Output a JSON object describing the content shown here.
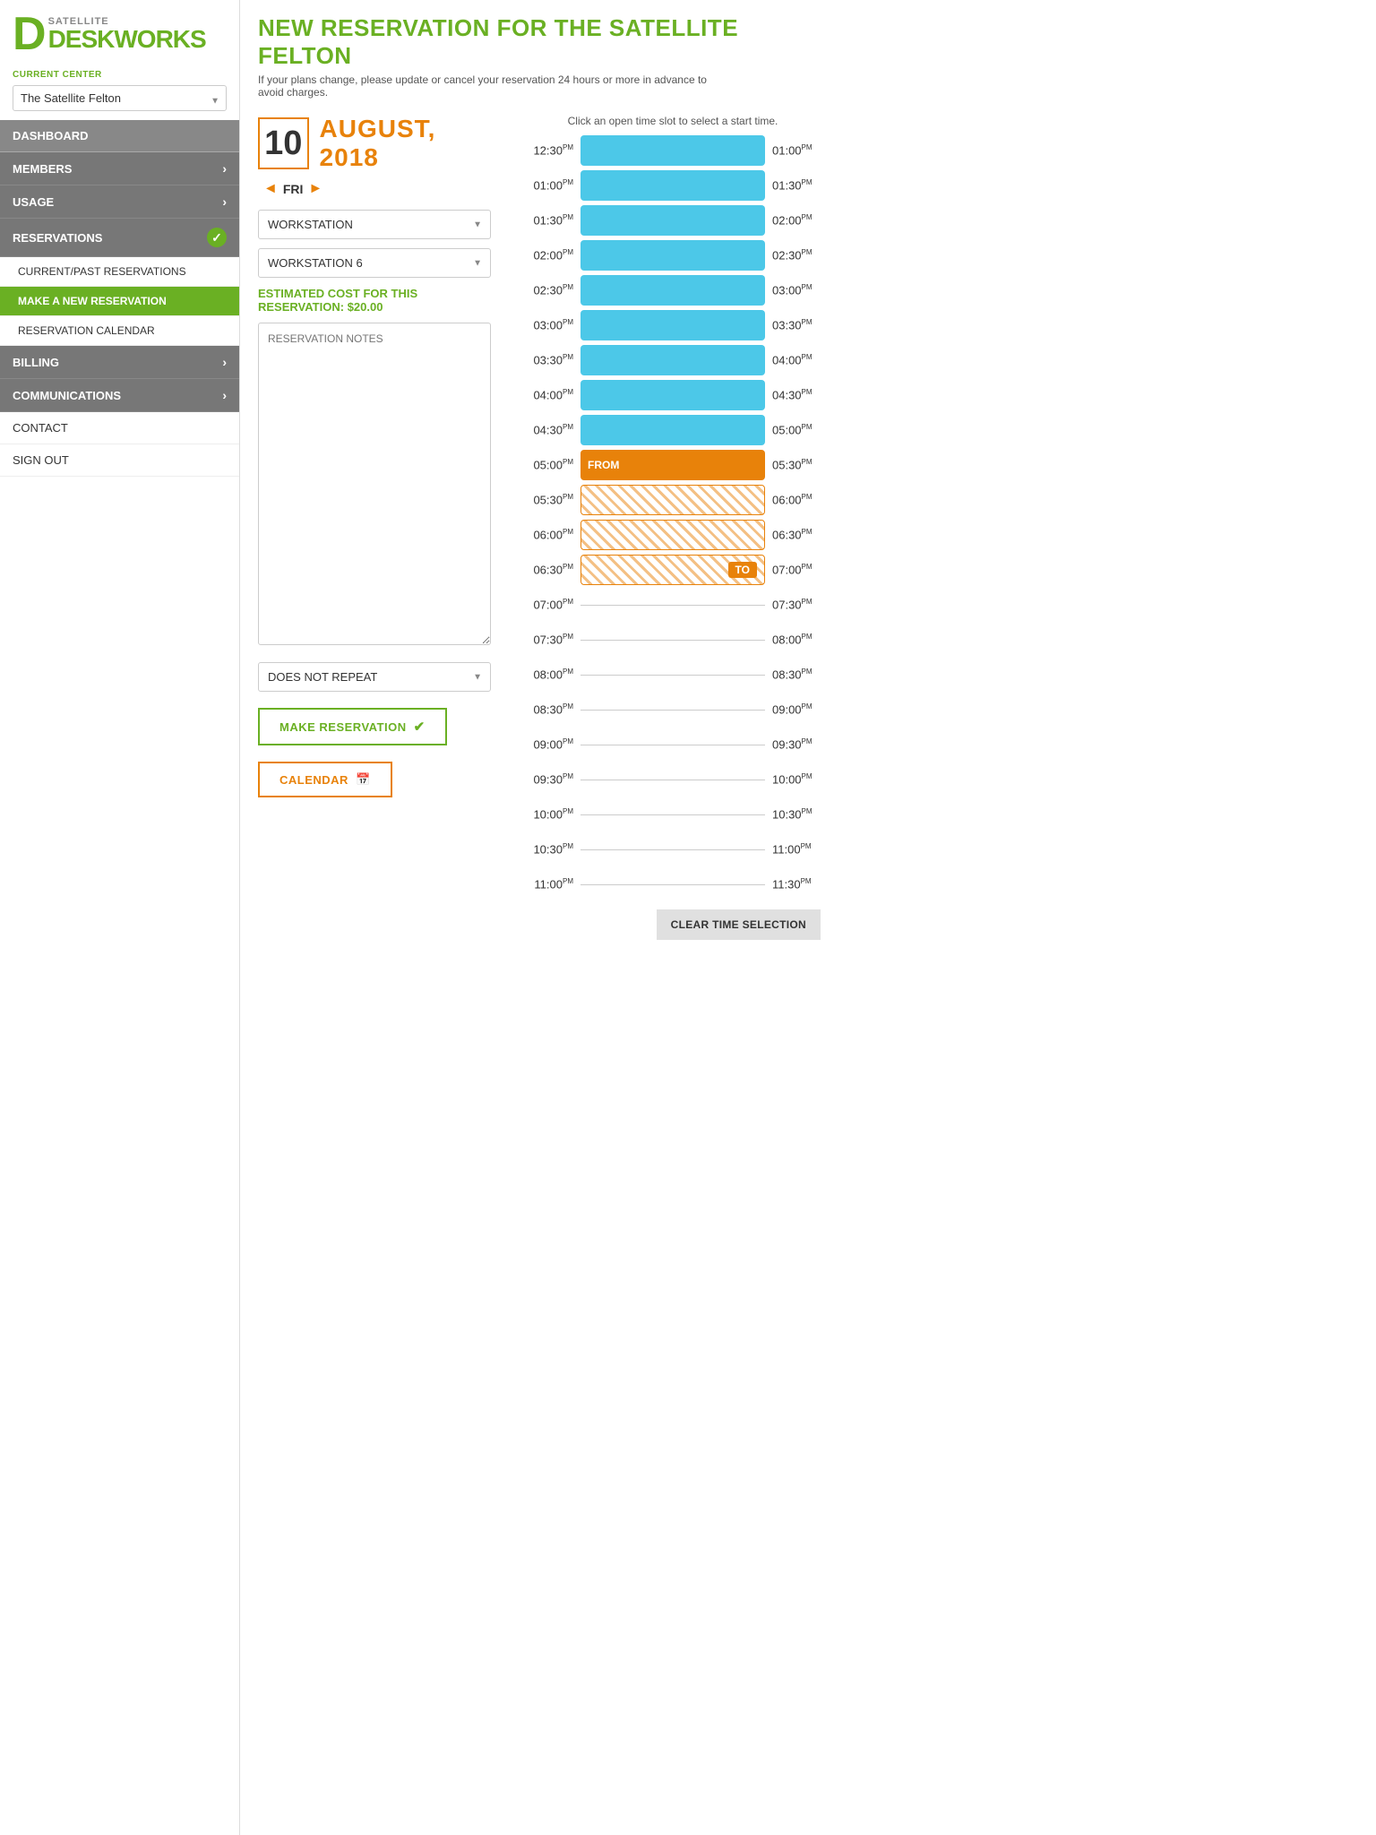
{
  "logo": {
    "d_letter": "D",
    "satellite": "SATELLITE",
    "eskworks": "ESKWORKS"
  },
  "sidebar": {
    "current_center_label": "CURRENT CENTER",
    "current_center": "The Satellite Felton",
    "nav": [
      {
        "id": "dashboard",
        "label": "DASHBOARD",
        "type": "plain-top"
      },
      {
        "id": "members",
        "label": "MEMBERS",
        "type": "expandable"
      },
      {
        "id": "usage",
        "label": "USAGE",
        "type": "expandable"
      },
      {
        "id": "reservations",
        "label": "RESERVATIONS",
        "type": "expandable-active"
      },
      {
        "id": "current-past",
        "label": "CURRENT/PAST RESERVATIONS",
        "type": "sub"
      },
      {
        "id": "make-new",
        "label": "MAKE A NEW RESERVATION",
        "type": "sub-active"
      },
      {
        "id": "calendar",
        "label": "RESERVATION CALENDAR",
        "type": "sub"
      },
      {
        "id": "billing",
        "label": "BILLING",
        "type": "expandable"
      },
      {
        "id": "communications",
        "label": "COMMUNICATIONS",
        "type": "expandable"
      },
      {
        "id": "contact",
        "label": "CONTACT",
        "type": "plain"
      },
      {
        "id": "signout",
        "label": "SIGN OUT",
        "type": "plain"
      }
    ]
  },
  "page": {
    "title": "NEW RESERVATION FOR THE SATELLITE FELTON",
    "subtitle": "If your plans change, please update or cancel your reservation 24 hours or more in advance to avoid charges.",
    "date_number": "10",
    "month_year": "AUGUST, 2018",
    "day_label": "FRI",
    "resource_type": "WORKSTATION",
    "resource_name": "WORKSTATION 6",
    "estimated_cost_label": "ESTIMATED COST FOR THIS",
    "reservation_label": "RESERVATION:",
    "estimated_cost_value": "$20.00",
    "notes_placeholder": "RESERVATION NOTES",
    "repeat_option": "DOES NOT REPEAT",
    "btn_make_reservation": "MAKE RESERVATION",
    "btn_calendar": "CALENDAR",
    "btn_clear": "CLEAR TIME SELECTION",
    "time_hint": "Click an open time slot to select a start time."
  },
  "time_slots": [
    {
      "left": "12:30",
      "left_sup": "PM",
      "type": "blue",
      "right": "01:00",
      "right_sup": "PM"
    },
    {
      "left": "01:00",
      "left_sup": "PM",
      "type": "blue",
      "right": "01:30",
      "right_sup": "PM"
    },
    {
      "left": "01:30",
      "left_sup": "PM",
      "type": "blue",
      "right": "02:00",
      "right_sup": "PM"
    },
    {
      "left": "02:00",
      "left_sup": "PM",
      "type": "blue",
      "right": "02:30",
      "right_sup": "PM"
    },
    {
      "left": "02:30",
      "left_sup": "PM",
      "type": "blue",
      "right": "03:00",
      "right_sup": "PM"
    },
    {
      "left": "03:00",
      "left_sup": "PM",
      "type": "blue",
      "right": "03:30",
      "right_sup": "PM"
    },
    {
      "left": "03:30",
      "left_sup": "PM",
      "type": "blue",
      "right": "04:00",
      "right_sup": "PM"
    },
    {
      "left": "04:00",
      "left_sup": "PM",
      "type": "blue",
      "right": "04:30",
      "right_sup": "PM"
    },
    {
      "left": "04:30",
      "left_sup": "PM",
      "type": "blue",
      "right": "05:00",
      "right_sup": "PM"
    },
    {
      "left": "05:00",
      "left_sup": "PM",
      "type": "orange-from",
      "bar_label": "FROM",
      "right": "05:30",
      "right_sup": "PM"
    },
    {
      "left": "05:30",
      "left_sup": "PM",
      "type": "orange-hatched",
      "right": "06:00",
      "right_sup": "PM"
    },
    {
      "left": "06:00",
      "left_sup": "PM",
      "type": "orange-hatched",
      "right": "06:30",
      "right_sup": "PM"
    },
    {
      "left": "06:30",
      "left_sup": "PM",
      "type": "orange-to",
      "bar_label": "TO",
      "right": "07:00",
      "right_sup": "PM"
    },
    {
      "left": "07:00",
      "left_sup": "PM",
      "type": "empty",
      "right": "07:30",
      "right_sup": "PM"
    },
    {
      "left": "07:30",
      "left_sup": "PM",
      "type": "empty",
      "right": "08:00",
      "right_sup": "PM"
    },
    {
      "left": "08:00",
      "left_sup": "PM",
      "type": "empty",
      "right": "08:30",
      "right_sup": "PM"
    },
    {
      "left": "08:30",
      "left_sup": "PM",
      "type": "empty",
      "right": "09:00",
      "right_sup": "PM"
    },
    {
      "left": "09:00",
      "left_sup": "PM",
      "type": "empty",
      "right": "09:30",
      "right_sup": "PM"
    },
    {
      "left": "09:30",
      "left_sup": "PM",
      "type": "empty",
      "right": "10:00",
      "right_sup": "PM"
    },
    {
      "left": "10:00",
      "left_sup": "PM",
      "type": "empty",
      "right": "10:30",
      "right_sup": "PM"
    },
    {
      "left": "10:30",
      "left_sup": "PM",
      "type": "empty",
      "right": "11:00",
      "right_sup": "PM"
    },
    {
      "left": "11:00",
      "left_sup": "PM",
      "type": "empty",
      "right": "11:30",
      "right_sup": "PM"
    }
  ]
}
